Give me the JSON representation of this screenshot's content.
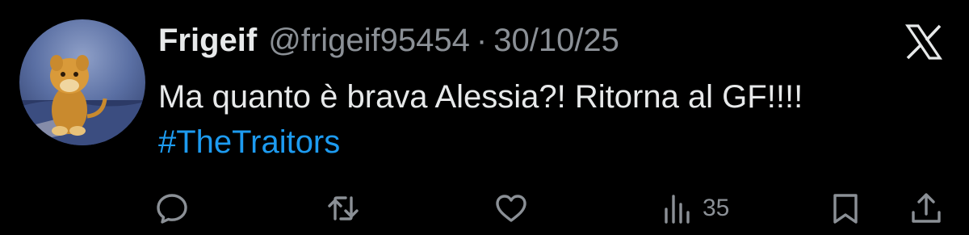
{
  "tweet": {
    "display_name": "Frigeif",
    "handle": "@frigeif95454",
    "separator": "·",
    "date": "30/10/25",
    "text": "Ma quanto è brava Alessia?! Ritorna al GF!!!!",
    "hashtag": "#TheTraitors"
  },
  "platform_logo": "x-logo",
  "avatar_icon": "lion-cub-figure",
  "actions": {
    "reply_icon": "reply-icon",
    "retweet_icon": "retweet-icon",
    "like_icon": "heart-icon",
    "views_icon": "views-bar-chart-icon",
    "views_count": "35",
    "bookmark_icon": "bookmark-icon",
    "share_icon": "share-icon"
  },
  "colors": {
    "background": "#000000",
    "text": "#e7e9ea",
    "muted": "#8b9096",
    "link": "#1d9bf0"
  }
}
